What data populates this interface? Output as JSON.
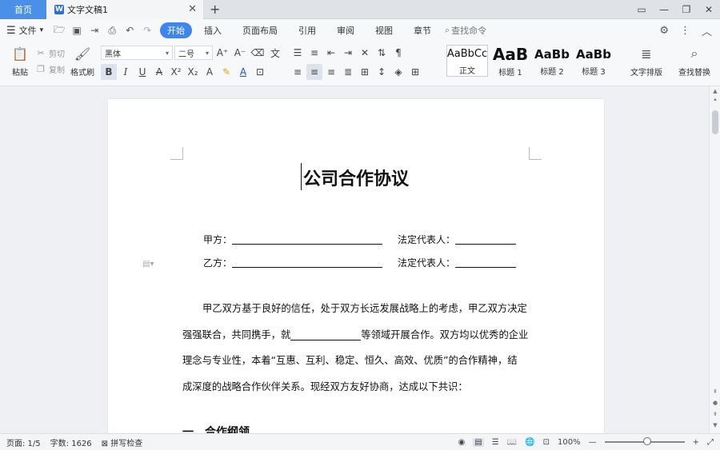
{
  "tabs": {
    "home": "首页",
    "document": "文字文稿1",
    "add": "+"
  },
  "window": {
    "tile_icon": "tile-icon",
    "minimize": "—",
    "restore": "❐",
    "close": "✕"
  },
  "menubar": {
    "file": "文件",
    "tabs": [
      "开始",
      "插入",
      "页面布局",
      "引用",
      "审阅",
      "视图",
      "章节"
    ],
    "search": "查找命令"
  },
  "ribbon": {
    "paste": "粘贴",
    "cut": "剪切",
    "copy": "复制",
    "format_painter": "格式刷",
    "font_name": "黑体",
    "font_size": "二号",
    "styles": [
      {
        "sample": "AaBbCc",
        "label": "正文"
      },
      {
        "sample": "AaB",
        "label": "标题 1"
      },
      {
        "sample": "AaBb",
        "label": "标题 2"
      },
      {
        "sample": "AaBb",
        "label": "标题 3"
      }
    ],
    "text_layout": "文字排版",
    "find_replace": "查找替换"
  },
  "document": {
    "title": "公司合作协议",
    "party_a_label": "甲方：",
    "party_b_label": "乙方：",
    "legal_rep_label": "法定代表人：",
    "para_lines": [
      "甲乙双方基于良好的信任，处于双方长远发展战略上的考虑，甲乙双方决定",
      "强强联合，共同携手，就",
      "等领域开展合作。双方均以优秀的企业",
      "理念与专业性，本着“互惠、互利、稳定、恒久、高效、优质”的合作精神，结",
      "成深度的战略合作伙伴关系。现经双方友好协商，达成以下共识："
    ],
    "section_heading": "一、合作纲领"
  },
  "status": {
    "page": "页面: 1/5",
    "word_count": "字数: 1626",
    "spell_check": "拼写检查",
    "zoom": "100%",
    "zoom_level_percent": 100
  },
  "colors": {
    "accent": "#3d86f0",
    "home_tab": "#4a8fe8"
  }
}
